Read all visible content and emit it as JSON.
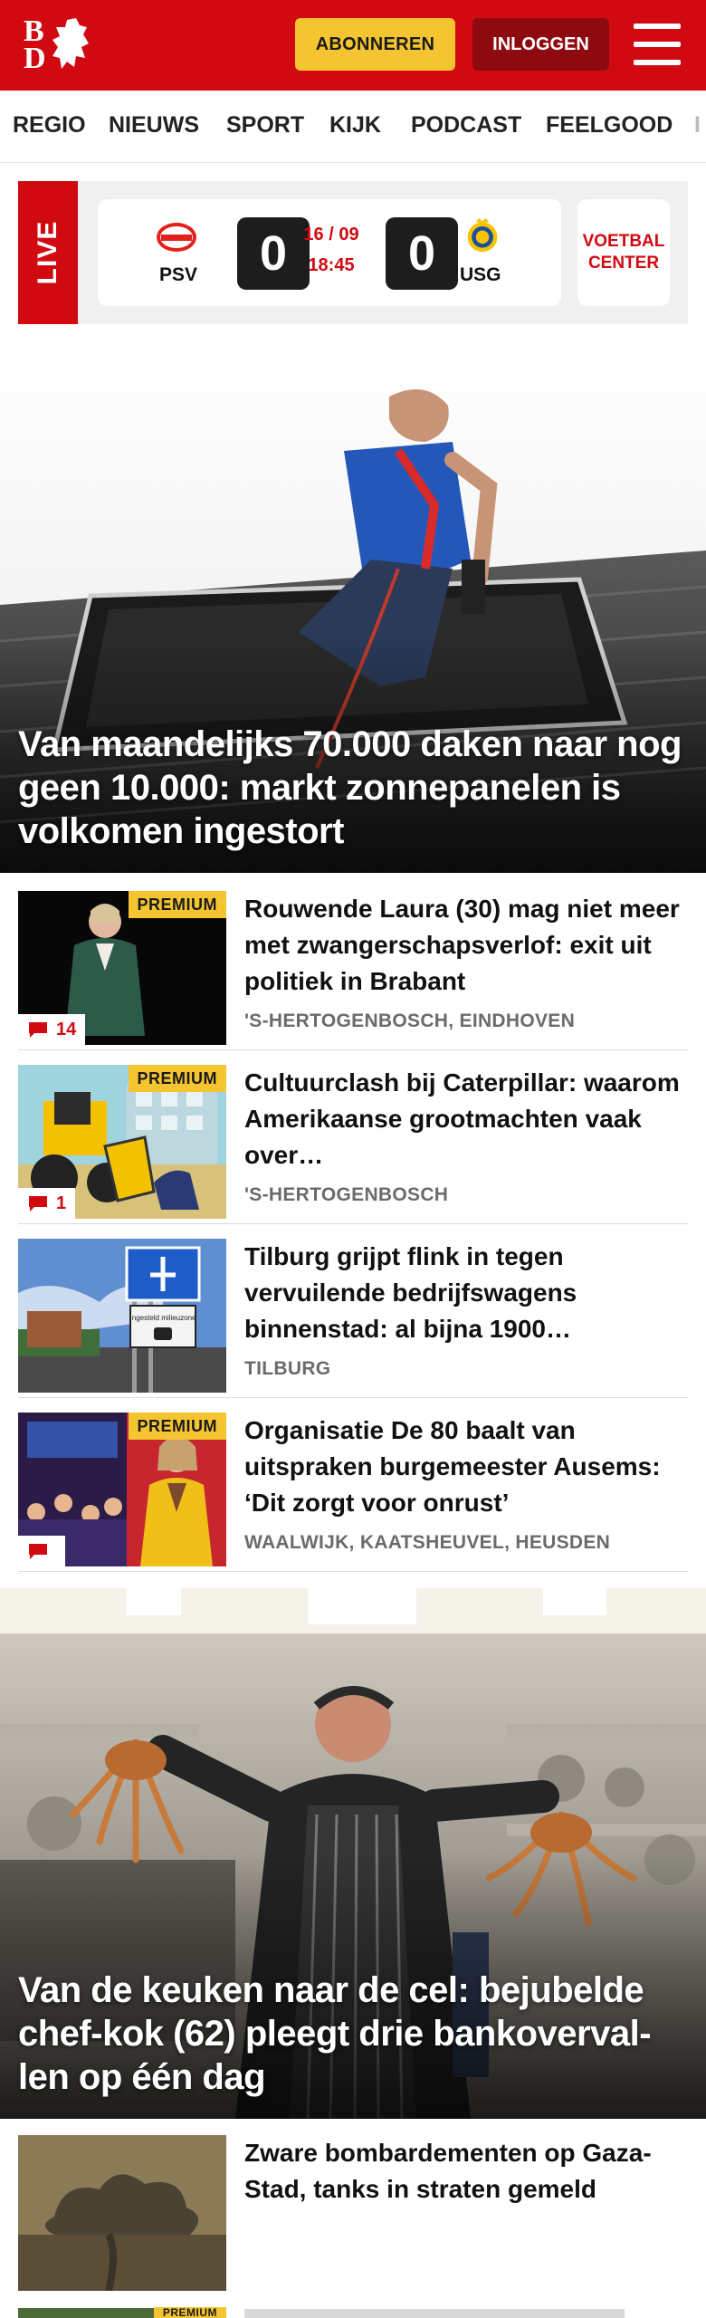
{
  "header": {
    "logo_top": "B",
    "logo_bottom": "D",
    "subscribe_label": "ABONNEREN",
    "login_label": "INLOGGEN",
    "colors": {
      "brand_red": "#d10a11",
      "accent_yellow": "#f5c531",
      "login_bg": "#8c0a10"
    }
  },
  "nav": {
    "items": [
      {
        "label": "REGIO"
      },
      {
        "label": "NIEUWS"
      },
      {
        "label": "SPORT"
      },
      {
        "label": "KIJK"
      },
      {
        "label": "PODCAST"
      },
      {
        "label": "FEELGOOD"
      },
      {
        "label": "I"
      }
    ]
  },
  "live": {
    "tag": "LIVE",
    "home_team": "PSV",
    "away_team": "USG",
    "home_score": "0",
    "away_score": "0",
    "date": "16 / 09",
    "time": "18:45",
    "football_center": "VOETBAL CENTER"
  },
  "hero1": {
    "title": "Van maandelijks 70.000 daken naar nog geen 10.000: markt zonnepanelen is volkomen ingestort"
  },
  "articles": [
    {
      "title": "Rouwende Laura (30) mag niet meer met zwangerschapsverlof: exit uit politiek in Brabant",
      "location": "'S-HERTOGENBOSCH, EINDHOVEN",
      "premium": "PREMIUM",
      "comments": "14"
    },
    {
      "title": "Cultuurclash bij Caterpillar: waarom Amerikaanse grootmachten vaak over…",
      "location": "'S-HERTOGENBOSCH",
      "premium": "PREMIUM",
      "comments": "1"
    },
    {
      "title": "Tilburg grijpt flink in tegen vervuilende bedrijfswagens binnenstad: al bijna 1900…",
      "location": "TILBURG",
      "sign_text": "Ingesteld milieuzone"
    },
    {
      "title": "Organisatie De 80 baalt van uitspraken burgemeester Ausems: ‘Dit zorgt voor onrust’",
      "location": "WAALWIJK, KAATSHEUVEL, HEUSDEN",
      "premium": "PREMIUM",
      "comments": ""
    }
  ],
  "hero2": {
    "title": "Van de keuken naar de cel: bejubelde chef-kok (62) pleegt drie bankoverval­len op één dag"
  },
  "article5": {
    "title": "Zware bombardementen op Ga­za-Stad, tanks in straten gemeld"
  },
  "article6": {
    "premium": "PREMIUM"
  }
}
